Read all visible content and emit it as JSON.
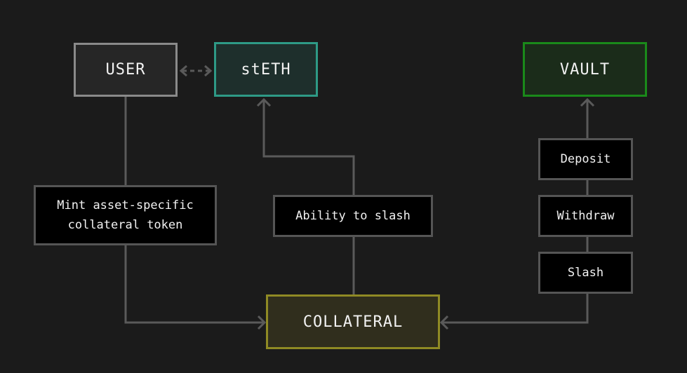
{
  "diagram": {
    "nodes": {
      "user": {
        "label": "USER"
      },
      "steth": {
        "label": "stETH"
      },
      "vault": {
        "label": "VAULT"
      },
      "collateral": {
        "label": "COLLATERAL"
      },
      "mint": {
        "line1": "Mint asset-specific",
        "line2": "collateral token"
      },
      "ability": {
        "label": "Ability to slash"
      },
      "deposit": {
        "label": "Deposit"
      },
      "withdraw": {
        "label": "Withdraw"
      },
      "slash": {
        "label": "Slash"
      }
    },
    "edges": [
      {
        "from": "user",
        "to": "steth",
        "style": "dashed",
        "arrows": "both"
      },
      {
        "from": "user",
        "to": "collateral",
        "via": "mint",
        "arrows": "end"
      },
      {
        "from": "collateral",
        "to": "steth",
        "via": "ability",
        "arrows": "end"
      },
      {
        "from": "collateral",
        "to": "vault",
        "via": [
          "slash",
          "withdraw",
          "deposit"
        ],
        "arrows": "both"
      }
    ],
    "colors": {
      "background": "#1b1b1b",
      "connector": "#5a5a5a",
      "user_border": "#8a8a8a",
      "steth_border": "#2e9a86",
      "vault_border": "#1a8a1a",
      "collateral_border": "#8f8a24"
    }
  }
}
